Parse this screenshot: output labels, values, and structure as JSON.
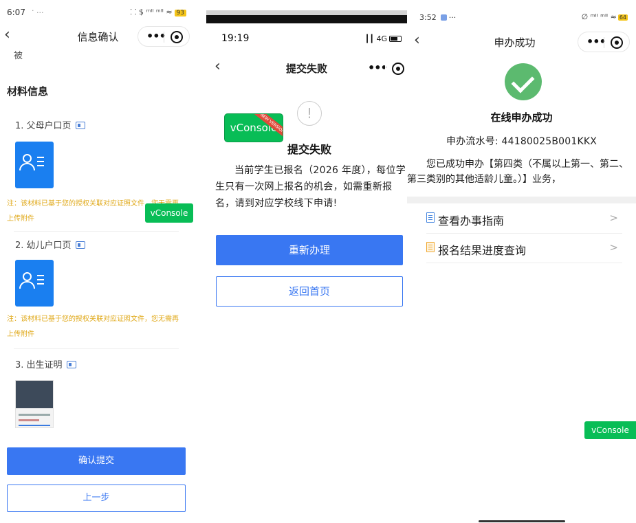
{
  "panel1": {
    "status": {
      "time": "6:07",
      "dots": "· ...",
      "signal": "⸬ $ ᵐᴵᴵ ᵐᴵᴵ ≈",
      "battery": "93"
    },
    "nav": {
      "back": "‹",
      "title": "信息确认"
    },
    "partial_text": "被",
    "section_title": "材料信息",
    "materials": [
      {
        "label": "1. 父母户口页",
        "note": "注：该材料已基于您的授权关联对应证照文件，您无需再上传附件"
      },
      {
        "label": "2. 幼儿户口页",
        "note": "注：该材料已基于您的授权关联对应证照文件，您无需再上传附件"
      },
      {
        "label": "3. 出生证明"
      }
    ],
    "vconsole": "vConsole",
    "confirm_button": "确认提交",
    "prev_button": "上一步"
  },
  "panel2": {
    "status": {
      "time": "19:19",
      "network": "┃┃ 4G"
    },
    "nav": {
      "back": "‹",
      "title": "提交失败"
    },
    "vconsole": "vConsole",
    "vconsole_ribbon": "NEW VERSION",
    "warn_symbol": "!",
    "fail_title": "提交失败",
    "message": "当前学生已报名（2026 年度），每位学生只有一次网上报名的机会，如需重新报名，请到对应学校线下申请!",
    "redo_button": "重新办理",
    "home_button": "返回首页"
  },
  "panel3": {
    "status": {
      "time": "3:52",
      "dots": "···",
      "signal": "∅ ᵐᴵᴵ ᵐᴵᴵ ≈",
      "battery": "64"
    },
    "nav": {
      "back": "‹",
      "title": "申办成功"
    },
    "success_title": "在线申办成功",
    "serial": "申办流水号: 44180025B001KKX",
    "description": "您已成功申办【第四类（不属以上第一、第二、第三类别的其他适龄儿童。）】业务，",
    "menu": [
      {
        "label": "查看办事指南",
        "chevron": ">"
      },
      {
        "label": "报名结果进度查询",
        "chevron": ">"
      }
    ],
    "vconsole": "vConsole"
  },
  "colors": {
    "primary": "#3977f2",
    "success": "#5cba6f",
    "vconsole": "#08bd56",
    "note": "#e0a91a"
  },
  "icons": [
    "more-icon",
    "target-icon",
    "id-card-icon",
    "check-icon",
    "warning-icon",
    "document-icon",
    "chevron-right-icon",
    "back-arrow-icon"
  ]
}
